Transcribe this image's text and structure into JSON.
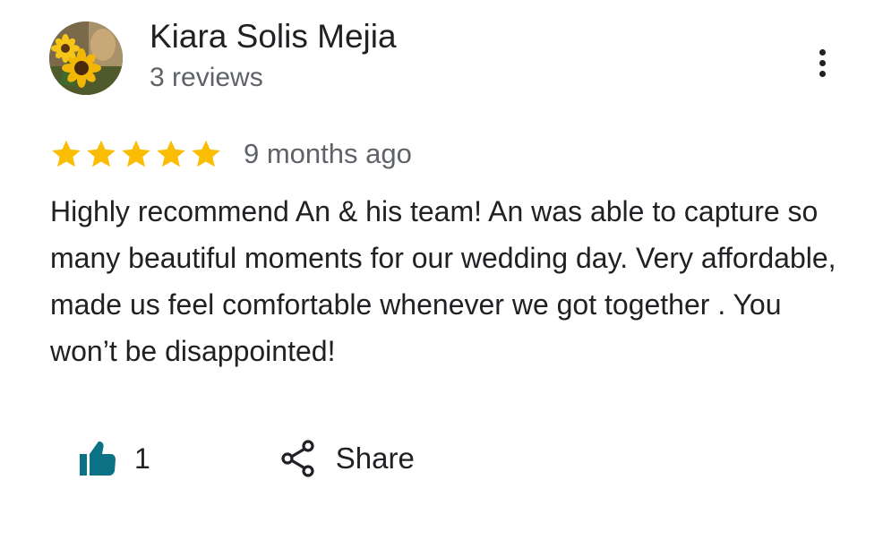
{
  "review": {
    "author": {
      "name": "Kiara Solis Mejia",
      "review_count": "3 reviews",
      "avatar_icon": "sunflower-avatar"
    },
    "more_options_icon": "more-vertical-icon",
    "rating": {
      "stars": 5,
      "max_stars": 5,
      "star_color": "#fbbc04",
      "date": "9 months ago"
    },
    "text": "Highly recommend An & his team! An was able to capture so many beautiful moments for our wedding day. Very affordable, made us feel comfortable whenever we got together . You won’t be disappointed!",
    "actions": {
      "like_icon": "thumbs-up-icon",
      "like_color": "#0b7285",
      "like_count": "1",
      "share_icon": "share-icon",
      "share_label": "Share"
    }
  }
}
